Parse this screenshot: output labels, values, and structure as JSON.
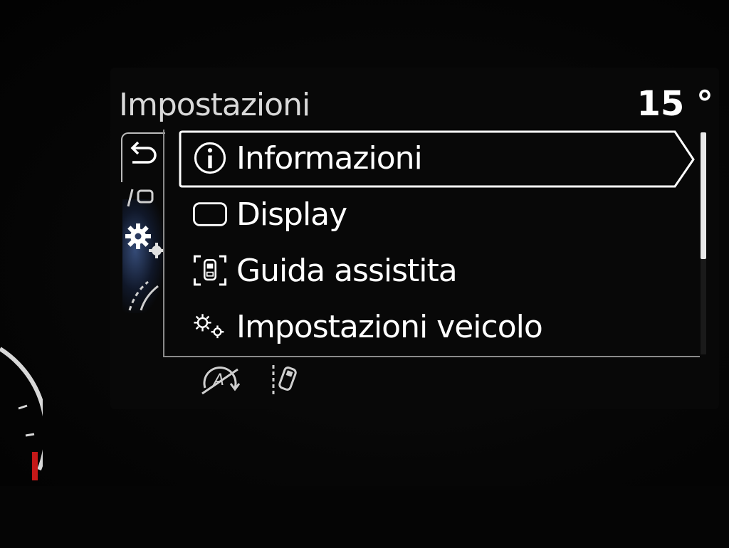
{
  "header": {
    "title": "Impostazioni",
    "temperature": "15 °"
  },
  "menu": {
    "items": [
      {
        "label": "Informazioni",
        "icon": "info-circle-icon",
        "selected": true
      },
      {
        "label": "Display",
        "icon": "display-icon",
        "selected": false
      },
      {
        "label": "Guida assistita",
        "icon": "driver-assist-icon",
        "selected": false
      },
      {
        "label": "Impostazioni veicolo",
        "icon": "gears-icon",
        "selected": false
      }
    ]
  },
  "side_tabs": [
    "back-icon",
    "road-car-icon",
    "settings-gears-icon",
    "lane-icon"
  ],
  "bottom_tabs": [
    "auto-start-stop-off-icon",
    "lane-keep-icon"
  ],
  "scroll": {
    "position_fraction": 0.0,
    "visible_fraction": 0.57
  },
  "colors": {
    "text": "#ffffff",
    "title": "#d9d9d9",
    "frame": "#8a8a8a",
    "accent_glow": "#5a82d2"
  }
}
